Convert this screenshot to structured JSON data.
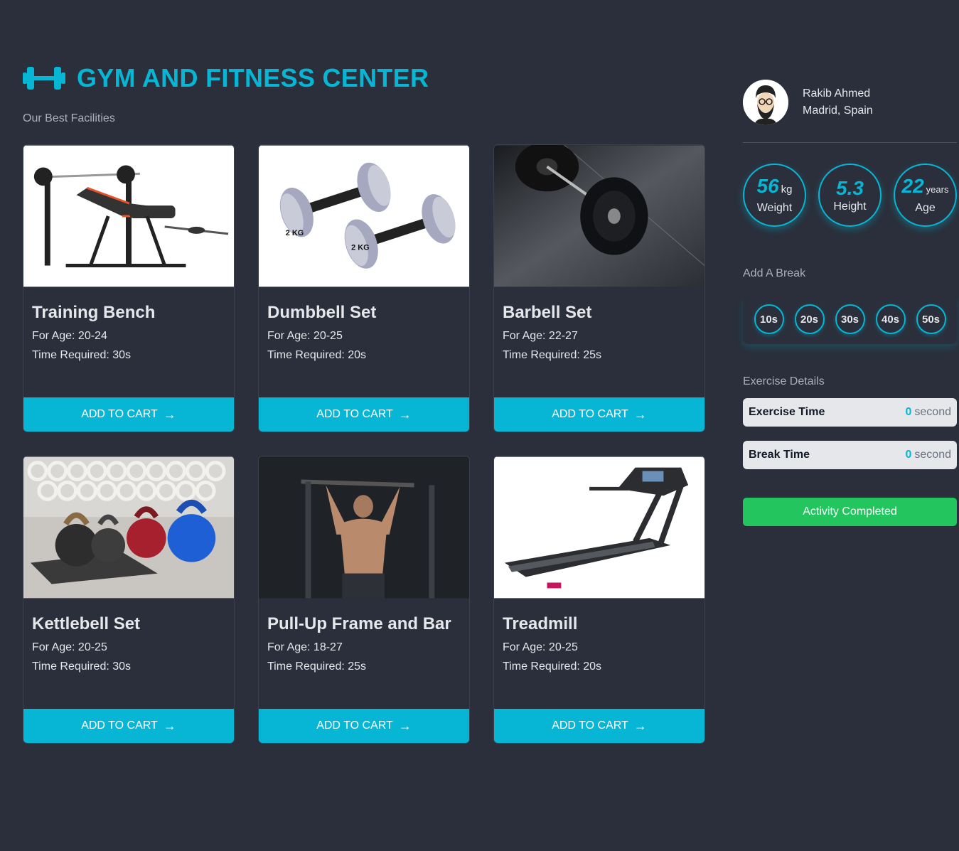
{
  "header": {
    "title": "GYM AND FITNESS CENTER",
    "subtitle": "Our Best Facilities",
    "logo_icon": "dumbbell-icon"
  },
  "cards": [
    {
      "name": "Training Bench",
      "age": "For Age: 20-24",
      "time": "Time Required: 30s",
      "button": "ADD TO CART",
      "image": "training-bench-image"
    },
    {
      "name": "Dumbbell Set",
      "age": "For Age: 20-25",
      "time": "Time Required: 20s",
      "button": "ADD TO CART",
      "image": "dumbbell-set-image",
      "image_labels": [
        "2 KG",
        "2 KG"
      ]
    },
    {
      "name": "Barbell Set",
      "age": "For Age: 22-27",
      "time": "Time Required: 25s",
      "button": "ADD TO CART",
      "image": "barbell-set-image"
    },
    {
      "name": "Kettlebell Set",
      "age": "For Age: 20-25",
      "time": "Time Required: 30s",
      "button": "ADD TO CART",
      "image": "kettlebell-set-image"
    },
    {
      "name": "Pull-Up Frame and Bar",
      "age": "For Age: 18-27",
      "time": "Time Required: 25s",
      "button": "ADD TO CART",
      "image": "pull-up-frame-image"
    },
    {
      "name": "Treadmill",
      "age": "For Age: 20-25",
      "time": "Time Required: 20s",
      "button": "ADD TO CART",
      "image": "treadmill-image"
    }
  ],
  "profile": {
    "name": "Rakib Ahmed",
    "location": "Madrid, Spain"
  },
  "stats": [
    {
      "value": "56",
      "unit": "kg",
      "label": "Weight"
    },
    {
      "value": "5.3",
      "unit": "",
      "label": "Height"
    },
    {
      "value": "22",
      "unit": "years",
      "label": "Age"
    }
  ],
  "break_section": {
    "label": "Add A Break",
    "options": [
      "10s",
      "20s",
      "30s",
      "40s",
      "50s"
    ]
  },
  "details": {
    "label": "Exercise Details",
    "exercise_time_label": "Exercise Time",
    "exercise_time_value": "0",
    "break_time_label": "Break Time",
    "break_time_value": "0",
    "unit": "second"
  },
  "complete_button": "Activity Completed",
  "colors": {
    "accent": "#06b6d4",
    "background": "#2a2f3b",
    "success": "#22c55e"
  }
}
